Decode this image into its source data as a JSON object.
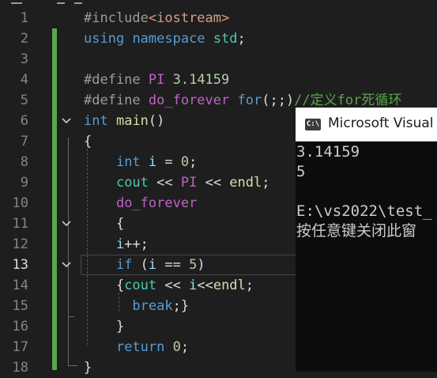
{
  "editor": {
    "current_line": 13,
    "lines": [
      {
        "n": "1",
        "tokens": [
          {
            "c": "pp",
            "t": "#include"
          },
          {
            "c": "hdr",
            "t": "<iostream>"
          }
        ]
      },
      {
        "n": "2",
        "tokens": [
          {
            "c": "kw",
            "t": "using"
          },
          {
            "c": "plain",
            "t": " "
          },
          {
            "c": "kw",
            "t": "namespace"
          },
          {
            "c": "plain",
            "t": " "
          },
          {
            "c": "ns",
            "t": "std"
          },
          {
            "c": "plain",
            "t": ";"
          }
        ]
      },
      {
        "n": "3",
        "tokens": []
      },
      {
        "n": "4",
        "tokens": [
          {
            "c": "pp",
            "t": "#define "
          },
          {
            "c": "mac",
            "t": "PI"
          },
          {
            "c": "num",
            "t": " 3.14159"
          }
        ]
      },
      {
        "n": "5",
        "tokens": [
          {
            "c": "pp",
            "t": "#define "
          },
          {
            "c": "mac",
            "t": "do_forever"
          },
          {
            "c": "plain",
            "t": " "
          },
          {
            "c": "kw",
            "t": "for"
          },
          {
            "c": "plain",
            "t": "(;;)"
          },
          {
            "c": "cmt",
            "t": "//定义for死循环"
          }
        ]
      },
      {
        "n": "6",
        "tokens": [
          {
            "c": "kw",
            "t": "int"
          },
          {
            "c": "plain",
            "t": " "
          },
          {
            "c": "fn",
            "t": "main"
          },
          {
            "c": "plain",
            "t": "()"
          }
        ]
      },
      {
        "n": "7",
        "tokens": [
          {
            "c": "plain",
            "t": "{"
          }
        ]
      },
      {
        "n": "8",
        "tokens": [
          {
            "c": "plain",
            "t": "    "
          },
          {
            "c": "kw",
            "t": "int"
          },
          {
            "c": "plain",
            "t": " "
          },
          {
            "c": "var",
            "t": "i"
          },
          {
            "c": "plain",
            "t": " = "
          },
          {
            "c": "num",
            "t": "0"
          },
          {
            "c": "plain",
            "t": ";"
          }
        ]
      },
      {
        "n": "9",
        "tokens": [
          {
            "c": "plain",
            "t": "    "
          },
          {
            "c": "ns",
            "t": "cout"
          },
          {
            "c": "plain",
            "t": " << "
          },
          {
            "c": "mac",
            "t": "PI"
          },
          {
            "c": "plain",
            "t": " << "
          },
          {
            "c": "fn",
            "t": "endl"
          },
          {
            "c": "plain",
            "t": ";"
          }
        ]
      },
      {
        "n": "10",
        "tokens": [
          {
            "c": "plain",
            "t": "    "
          },
          {
            "c": "mac",
            "t": "do_forever"
          }
        ]
      },
      {
        "n": "11",
        "tokens": [
          {
            "c": "plain",
            "t": "    {"
          }
        ]
      },
      {
        "n": "12",
        "tokens": [
          {
            "c": "plain",
            "t": "    "
          },
          {
            "c": "var",
            "t": "i"
          },
          {
            "c": "plain",
            "t": "++;"
          }
        ]
      },
      {
        "n": "13",
        "tokens": [
          {
            "c": "plain",
            "t": "    "
          },
          {
            "c": "kw",
            "t": "if"
          },
          {
            "c": "plain",
            "t": " ("
          },
          {
            "c": "var",
            "t": "i"
          },
          {
            "c": "plain",
            "t": " == "
          },
          {
            "c": "num",
            "t": "5"
          },
          {
            "c": "plain",
            "t": ")"
          }
        ]
      },
      {
        "n": "14",
        "tokens": [
          {
            "c": "plain",
            "t": "    {"
          },
          {
            "c": "ns",
            "t": "cout"
          },
          {
            "c": "plain",
            "t": " << "
          },
          {
            "c": "var",
            "t": "i"
          },
          {
            "c": "plain",
            "t": "<<"
          },
          {
            "c": "fn",
            "t": "endl"
          },
          {
            "c": "plain",
            "t": ";"
          }
        ]
      },
      {
        "n": "15",
        "tokens": [
          {
            "c": "plain",
            "t": "      "
          },
          {
            "c": "kw",
            "t": "break"
          },
          {
            "c": "plain",
            "t": ";}"
          }
        ]
      },
      {
        "n": "16",
        "tokens": [
          {
            "c": "plain",
            "t": "    }"
          }
        ]
      },
      {
        "n": "17",
        "tokens": [
          {
            "c": "plain",
            "t": "    "
          },
          {
            "c": "kw",
            "t": "return"
          },
          {
            "c": "plain",
            "t": " "
          },
          {
            "c": "num",
            "t": "0"
          },
          {
            "c": "plain",
            "t": ";"
          }
        ]
      },
      {
        "n": "18",
        "tokens": [
          {
            "c": "plain",
            "t": "}"
          }
        ]
      }
    ],
    "fold_markers": [
      {
        "line": 6,
        "icon": "chevron-down-icon"
      },
      {
        "line": 11,
        "icon": "chevron-down-icon"
      },
      {
        "line": 13,
        "icon": "chevron-down-icon"
      }
    ]
  },
  "console": {
    "title": "Microsoft Visual",
    "icon": "console-app-icon",
    "icon_text": "C:\\",
    "lines": [
      "3.14159",
      "5",
      "",
      "E:\\vs2022\\test_",
      "按任意键关闭此窗"
    ]
  }
}
